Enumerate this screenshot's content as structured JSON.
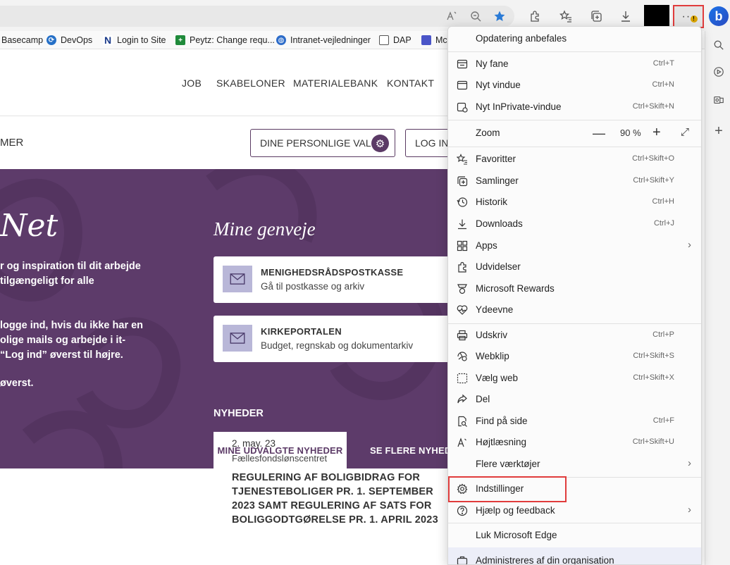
{
  "toolbar": {
    "icons": [
      "read-aloud-icon",
      "zoom-icon",
      "favorite-star-icon",
      "extensions-icon",
      "favorites-icon",
      "collections-icon",
      "downloads-icon",
      "more-icon",
      "copilot-icon"
    ]
  },
  "favorites": [
    {
      "label": "Basecamp",
      "icon": "none"
    },
    {
      "label": "DevOps",
      "icon": "devops-icon"
    },
    {
      "label": "Login to Site",
      "icon": "n-icon"
    },
    {
      "label": "Peytz: Change requ...",
      "icon": "plus-icon"
    },
    {
      "label": "Intranet-vejledninger",
      "icon": "globe-icon"
    },
    {
      "label": "DAP",
      "icon": "page-icon"
    },
    {
      "label": "Mc",
      "icon": "bookmark-icon"
    }
  ],
  "page": {
    "nav": [
      "JOB",
      "SKABELONER",
      "MATERIALEBANK",
      "KONTAKT"
    ],
    "left_fragment": "MER",
    "personal_button": "DINE PERSONLIGE VALG",
    "login_button": "LOG IND",
    "hero_title_fragment": "Net",
    "hero_lines_1": [
      "r og inspiration til dit arbejde",
      "tilgængeligt for alle"
    ],
    "hero_lines_2": [
      "logge ind, hvis du ikke har en",
      "olige mails og arbejde i it-",
      "“Log ind” øverst til højre."
    ],
    "hero_lines_3": [
      "øverst."
    ],
    "shortcuts_heading": "Mine genveje",
    "shortcuts": [
      {
        "title": "MENIGHEDSRÅDSPOSTKASSE",
        "subtitle": "Gå til postkasse og arkiv"
      },
      {
        "title": "KIRKEPORTALEN",
        "subtitle": "Budget, regnskab og dokumentarkiv"
      }
    ],
    "news_heading": "NYHEDER",
    "news_tabs": [
      "MINE UDVALGTE NYHEDER",
      "SE FLERE NYHEDER"
    ],
    "news_item": {
      "date": "2. may. 23",
      "source": "Fællesfondslønscentret",
      "title": "REGULERING AF BOLIGBIDRAG FOR TJENESTEBOLIGER PR. 1. SEPTEMBER 2023 SAMT REGULERING AF SATS FOR BOLIGGODTGØRELSE PR. 1. APRIL 2023"
    }
  },
  "menu": {
    "update": "Opdatering anbefales",
    "items": [
      {
        "label": "Ny fane",
        "shortcut": "Ctrl+T",
        "icon": "new-tab-icon"
      },
      {
        "label": "Nyt vindue",
        "shortcut": "Ctrl+N",
        "icon": "new-window-icon"
      },
      {
        "label": "Nyt InPrivate-vindue",
        "shortcut": "Ctrl+Skift+N",
        "icon": "inprivate-icon"
      },
      {
        "label": "Favoritter",
        "shortcut": "Ctrl+Skift+O",
        "icon": "favorites-icon"
      },
      {
        "label": "Samlinger",
        "shortcut": "Ctrl+Skift+Y",
        "icon": "collections-icon"
      },
      {
        "label": "Historik",
        "shortcut": "Ctrl+H",
        "icon": "history-icon"
      },
      {
        "label": "Downloads",
        "shortcut": "Ctrl+J",
        "icon": "download-icon"
      },
      {
        "label": "Apps",
        "shortcut": "",
        "icon": "apps-icon"
      },
      {
        "label": "Udvidelser",
        "shortcut": "",
        "icon": "extensions-icon"
      },
      {
        "label": "Microsoft Rewards",
        "shortcut": "",
        "icon": "rewards-icon"
      },
      {
        "label": "Ydeevne",
        "shortcut": "",
        "icon": "performance-icon"
      },
      {
        "label": "Udskriv",
        "shortcut": "Ctrl+P",
        "icon": "print-icon"
      },
      {
        "label": "Webklip",
        "shortcut": "Ctrl+Skift+S",
        "icon": "webcapture-icon"
      },
      {
        "label": "Vælg web",
        "shortcut": "Ctrl+Skift+X",
        "icon": "webselect-icon"
      },
      {
        "label": "Del",
        "shortcut": "",
        "icon": "share-icon"
      },
      {
        "label": "Find på side",
        "shortcut": "Ctrl+F",
        "icon": "find-icon"
      },
      {
        "label": "Højtlæsning",
        "shortcut": "Ctrl+Skift+U",
        "icon": "read-aloud-icon"
      },
      {
        "label": "Flere værktøjer",
        "shortcut": "",
        "icon": "none"
      },
      {
        "label": "Indstillinger",
        "shortcut": "",
        "icon": "settings-icon"
      },
      {
        "label": "Hjælp og feedback",
        "shortcut": "",
        "icon": "help-icon"
      },
      {
        "label": "Luk Microsoft Edge",
        "shortcut": "",
        "icon": "none"
      },
      {
        "label": "Administreres af din organisation",
        "shortcut": "",
        "icon": "briefcase-icon"
      }
    ],
    "zoom": {
      "label": "Zoom",
      "minus": "—",
      "value": "90 %",
      "plus": "+"
    }
  },
  "colors": {
    "brand_purple": "#5d3b6a",
    "highlight_red": "#e03c3c",
    "shortcut_icon_bg": "#b9b7d8"
  }
}
